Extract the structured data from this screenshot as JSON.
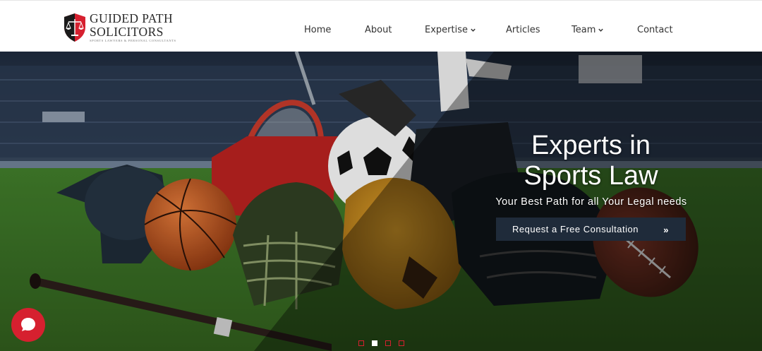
{
  "brand": {
    "line1": "GUIDED PATH",
    "line2": "SOLICITORS",
    "tagline": "SPORTS LAWYERS & PERSONAL CONSULTANTS",
    "colors": {
      "shield_red": "#d6202f",
      "shield_dark": "#1a1a1a",
      "text": "#2a2a2a"
    }
  },
  "nav": {
    "items": [
      {
        "label": "Home"
      },
      {
        "label": "About"
      },
      {
        "label": "Expertise",
        "has_dropdown": true
      },
      {
        "label": "Articles"
      },
      {
        "label": "Team",
        "has_dropdown": true
      },
      {
        "label": "Contact"
      }
    ]
  },
  "hero": {
    "title_line1": "Experts in",
    "title_line2": "Sports Law",
    "subtitle": "Your Best Path for all Your Legal needs",
    "cta_label": "Request a Free Consultation",
    "cta_icon": "double-chevron-right-icon",
    "slider": {
      "count": 4,
      "active_index": 1
    }
  },
  "chat": {
    "icon": "chat-bubble-icon",
    "color": "#d6202f"
  }
}
